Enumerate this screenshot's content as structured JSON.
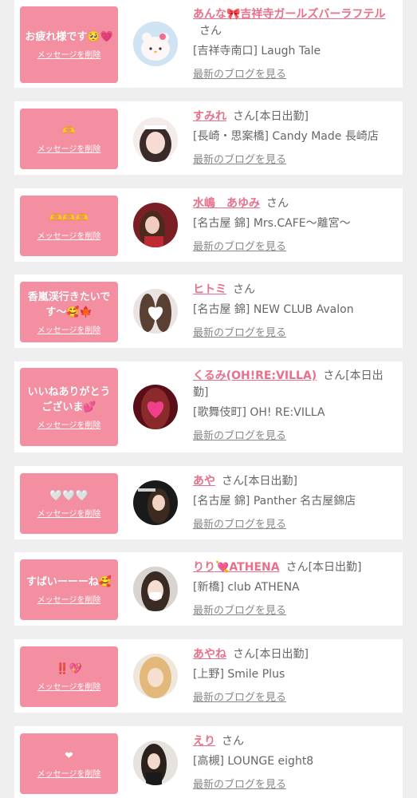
{
  "delete_label": "メッセージを削除",
  "blog_label": "最新のブログを見る",
  "san_label": "さん",
  "items": [
    {
      "message": "お疲れ様です🥺💗",
      "name": "あんな🎀吉祥寺ガールズバーラフテル",
      "on_duty": "",
      "shop": "[吉祥寺南口] Laugh Tale",
      "avatar_icon": "hello-kitty-avatar-icon"
    },
    {
      "message": "🫶",
      "name": "すみれ",
      "on_duty": "[本日出勤]",
      "shop": "[長崎・思案橋] Candy Made 長崎店",
      "avatar_icon": "girl-avatar-icon"
    },
    {
      "message": "🫶🫶🫶",
      "name": "水嶋　あゆみ",
      "on_duty": "",
      "shop": "[名古屋 錦] Mrs.CAFE～離宮～",
      "avatar_icon": "girl-avatar-icon"
    },
    {
      "message": "香嵐渓行きたいです〜🥰🍁",
      "name": "ヒトミ",
      "on_duty": "",
      "shop": "[名古屋 錦] NEW CLUB Avalon",
      "avatar_icon": "white-heart-avatar-icon"
    },
    {
      "message": "いいねありがとうございま💕",
      "name": "くるみ(OH!RE:VILLA)",
      "on_duty": "[本日出勤]",
      "shop": "[歌舞伎町] OH! RE:VILLA",
      "avatar_icon": "pink-heart-avatar-icon"
    },
    {
      "message": "🤍🤍🤍",
      "name": "あや",
      "on_duty": "[本日出勤]",
      "shop": "[名古屋 錦] Panther 名古屋錦店",
      "avatar_icon": "girl-avatar-icon"
    },
    {
      "message": "すばいーーーね🥰",
      "name": "りり💘ATHENA",
      "on_duty": "[本日出勤]",
      "shop": "[新橋] club ATHENA",
      "avatar_icon": "girl-avatar-icon"
    },
    {
      "message": "‼️💖",
      "name": "あやね",
      "on_duty": "[本日出勤]",
      "shop": "[上野] Smile Plus",
      "avatar_icon": "girl-avatar-icon"
    },
    {
      "message": "❤",
      "name": "えり",
      "on_duty": "",
      "shop": "[高槻] LOUNGE eight8",
      "avatar_icon": "girl-avatar-icon"
    }
  ]
}
